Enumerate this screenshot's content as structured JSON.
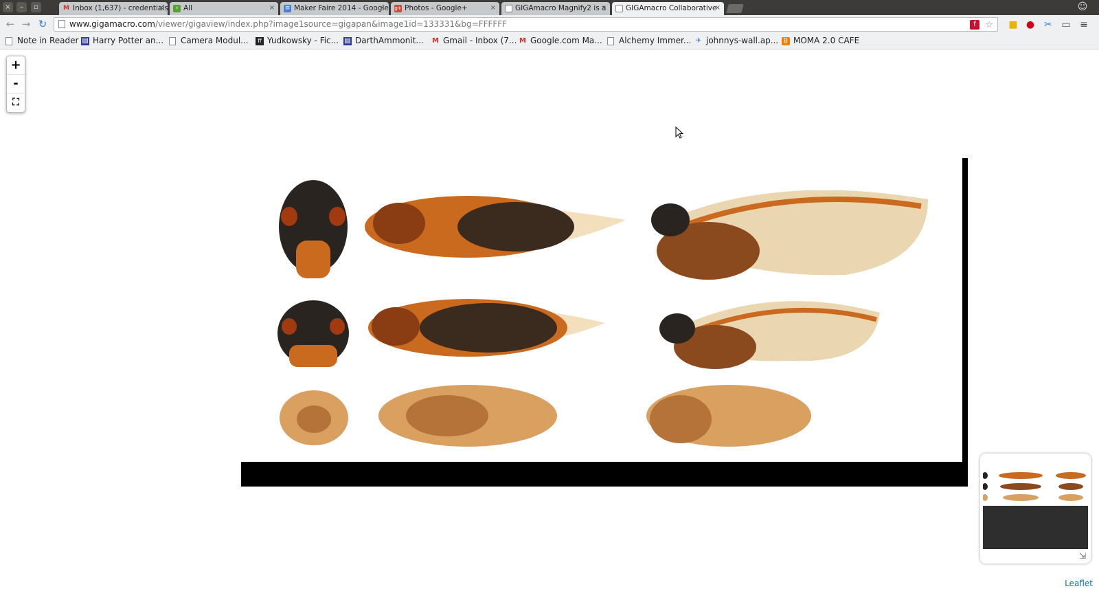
{
  "window": {
    "controls": [
      "×",
      "–",
      "▫"
    ]
  },
  "tabs": [
    {
      "title": "Inbox (1,637) - credentials",
      "favicon": "gmail-icon",
      "active": false
    },
    {
      "title": "All",
      "favicon": "back-arrow-icon",
      "active": false
    },
    {
      "title": "Maker Faire 2014 - Google",
      "favicon": "docs-icon",
      "active": false
    },
    {
      "title": "Photos - Google+",
      "favicon": "google-plus-icon",
      "active": false
    },
    {
      "title": "GIGAmacro Magnify2 is a",
      "favicon": "page-icon",
      "active": false
    },
    {
      "title": "GIGAmacro Collaborative",
      "favicon": "page-icon",
      "active": true
    }
  ],
  "toolbar": {
    "back": "←",
    "forward": "→",
    "reload": "↻",
    "url_host": "www.gigamacro.com",
    "url_path": "/viewer/gigaview/index.php?image1source=gigapan&image1id=133331&bg=FFFFFF",
    "menu": "≡"
  },
  "bookmarks": [
    {
      "label": "Note in Reader",
      "icon": "page-icon"
    },
    {
      "label": "Harry Potter an...",
      "icon": "book-icon"
    },
    {
      "label": "Camera Modul...",
      "icon": "page-icon"
    },
    {
      "label": "Yudkowsky - Fic...",
      "icon": "ff-icon"
    },
    {
      "label": "DarthAmmonit...",
      "icon": "book-icon"
    },
    {
      "label": "Gmail - Inbox (7...",
      "icon": "gmail-icon"
    },
    {
      "label": "Google.com Ma...",
      "icon": "gmail-icon"
    },
    {
      "label": "Alchemy Immer...",
      "icon": "page-icon"
    },
    {
      "label": "johnnys-wall.ap...",
      "icon": "appspot-icon"
    },
    {
      "label": "MOMA 2.0 CAFE",
      "icon": "blogger-icon"
    }
  ],
  "map": {
    "zoom_in": "+",
    "zoom_out": "-",
    "fit": "⛶",
    "attribution": "Leaflet",
    "minimap_toggle": "⇲"
  },
  "colors": {
    "tabstrip": "#3c3b37",
    "toolbar": "#eef0f1",
    "cicada_dark": "#2a2420",
    "cicada_orange": "#c96a1e",
    "nymph": "#d9a060",
    "link": "#0078a8"
  }
}
